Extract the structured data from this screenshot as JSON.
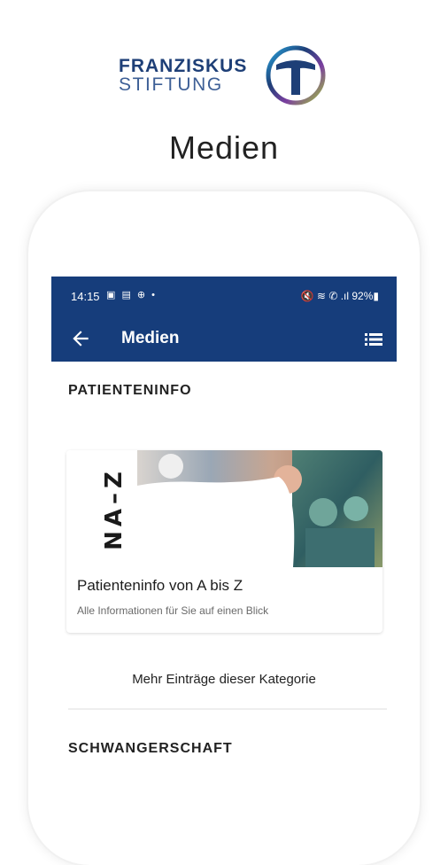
{
  "brand": {
    "line1": "FRANZISKUS",
    "line2": "STIFTUNG",
    "logo_icon": "tau-cross-logo"
  },
  "page_title": "Medien",
  "status_bar": {
    "time": "14:15",
    "icons_left": "▣ ▤ ⊕ •",
    "right": "🔇 ≋ ✆ .ıl 92%▮"
  },
  "app_bar": {
    "title": "Medien",
    "back_icon": "arrow-left-icon",
    "menu_icon": "list-view-icon"
  },
  "sections": [
    {
      "title": "PATIENTENINFO",
      "card": {
        "image_text": "NA–Z",
        "title": "Patienteninfo von A bis Z",
        "subtitle": "Alle Informationen für Sie auf einen Blick"
      },
      "more_label": "Mehr Einträge dieser Kategorie"
    },
    {
      "title": "SCHWANGERSCHAFT"
    }
  ],
  "colors": {
    "primary": "#163d7b",
    "brand_text": "#1e3f77"
  }
}
